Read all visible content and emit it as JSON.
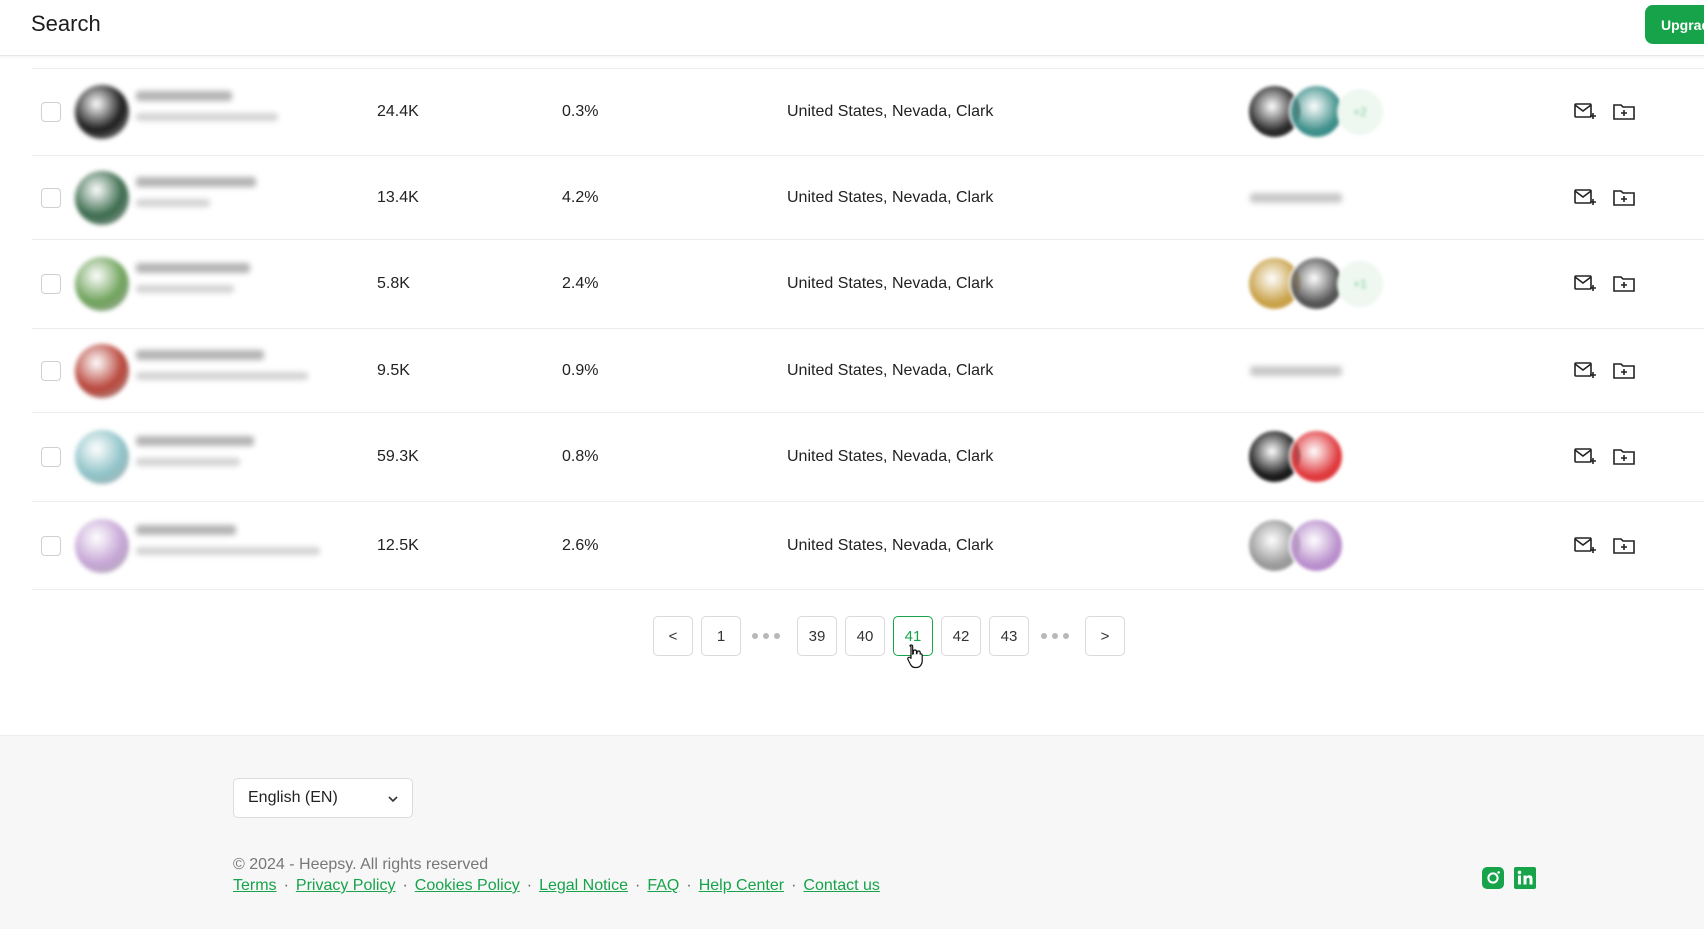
{
  "header": {
    "title": "Search",
    "upgrade_label": "Upgrade"
  },
  "rows": [
    {
      "followers": "24.4K",
      "engagement": "0.3%",
      "location": "United States, Nevada, Clark",
      "avatar_color": "#1b1b1b",
      "mentions": [
        "#2a2a2a",
        "#3e8f8a"
      ],
      "more": "+2"
    },
    {
      "followers": "13.4K",
      "engagement": "4.2%",
      "location": "United States, Nevada, Clark",
      "avatar_color": "#3a6b4d",
      "mentions": []
    },
    {
      "followers": "5.8K",
      "engagement": "2.4%",
      "location": "United States, Nevada, Clark",
      "avatar_color": "#6fa35b",
      "mentions": [
        "#c9a24a",
        "#555555"
      ],
      "more": "+1"
    },
    {
      "followers": "9.5K",
      "engagement": "0.9%",
      "location": "United States, Nevada, Clark",
      "avatar_color": "#b8453a",
      "mentions": []
    },
    {
      "followers": "59.3K",
      "engagement": "0.8%",
      "location": "United States, Nevada, Clark",
      "avatar_color": "#8fc3c8",
      "mentions": [
        "#1a1a1a",
        "#e03a3e"
      ]
    },
    {
      "followers": "12.5K",
      "engagement": "2.6%",
      "location": "United States, Nevada, Clark",
      "avatar_color": "#c6a6d6",
      "mentions": [
        "#9a9a9a",
        "#b98fcc"
      ]
    }
  ],
  "pagination": {
    "prev": "<",
    "next": ">",
    "first": "1",
    "pages": [
      "39",
      "40",
      "41",
      "42",
      "43"
    ],
    "current": "41"
  },
  "footer": {
    "language": "English (EN)",
    "copyright": "© 2024 - Heepsy. All rights reserved",
    "links": [
      "Terms",
      "Privacy Policy",
      "Cookies Policy",
      "Legal Notice",
      "FAQ",
      "Help Center",
      "Contact us"
    ]
  },
  "colors": {
    "accent": "#16a34a"
  }
}
